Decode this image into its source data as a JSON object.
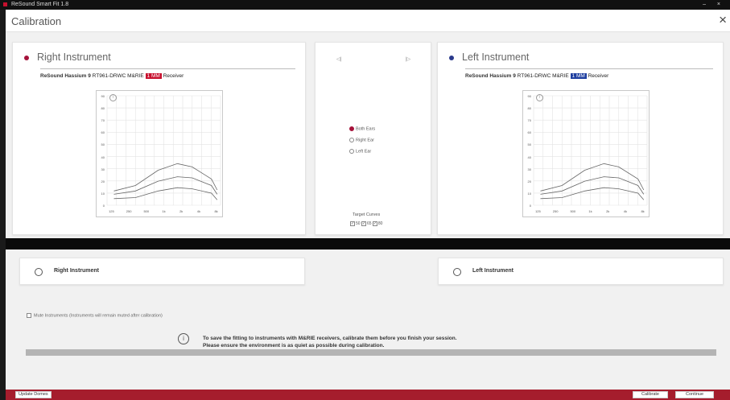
{
  "titlebar": {
    "app_title": "ReSound Smart Fit 1.8",
    "controls": "– ×"
  },
  "header": {
    "title": "Calibration",
    "close_glyph": "×"
  },
  "right_instrument": {
    "title": "Right Instrument",
    "dot_color": "#a5123a",
    "brand": "ReSound Hassium 9",
    "receiver_model": "RT961-DRWC M&RIE",
    "mm_badge": "1 MM",
    "mm_color": "#c8102e",
    "receiver_label": "Receiver"
  },
  "left_instrument": {
    "title": "Left Instrument",
    "dot_color": "#2a3a8c",
    "brand": "ReSound Hassium 9",
    "receiver_model": "RT961-DRWC M&RIE",
    "mm_badge": "1 MM",
    "mm_color": "#1f3fa0",
    "receiver_label": "Receiver"
  },
  "graph": {
    "info_glyph": "i",
    "y_ticks": [
      "90",
      "80",
      "70",
      "60",
      "50",
      "40",
      "30",
      "20",
      "10",
      "0"
    ],
    "x_ticks": [
      "125",
      "250",
      "500",
      "1k",
      "2k",
      "4k",
      "8k"
    ],
    "curves": [
      [
        [
          0.06,
          0.87
        ],
        [
          0.25,
          0.82
        ],
        [
          0.45,
          0.68
        ],
        [
          0.62,
          0.62
        ],
        [
          0.75,
          0.65
        ],
        [
          0.92,
          0.76
        ],
        [
          0.97,
          0.86
        ]
      ],
      [
        [
          0.06,
          0.9
        ],
        [
          0.25,
          0.87
        ],
        [
          0.45,
          0.78
        ],
        [
          0.62,
          0.74
        ],
        [
          0.75,
          0.75
        ],
        [
          0.92,
          0.82
        ],
        [
          0.97,
          0.9
        ]
      ],
      [
        [
          0.06,
          0.94
        ],
        [
          0.25,
          0.93
        ],
        [
          0.45,
          0.87
        ],
        [
          0.62,
          0.84
        ],
        [
          0.75,
          0.85
        ],
        [
          0.92,
          0.89
        ],
        [
          0.97,
          0.95
        ]
      ]
    ]
  },
  "center": {
    "right_icon": "◁|",
    "left_icon": "|▷",
    "ear_options": [
      {
        "label": "Both Ears",
        "selected": true
      },
      {
        "label": "Right Ear",
        "selected": false
      },
      {
        "label": "Left Ear",
        "selected": false
      }
    ],
    "target_curves_label": "Target Curves",
    "target_curves": [
      {
        "label": "50",
        "checked": true
      },
      {
        "label": "65",
        "checked": true
      },
      {
        "label": "80",
        "checked": true
      }
    ],
    "check_glyph": "✓"
  },
  "selection": {
    "right_label": "Right Instrument",
    "left_label": "Left Instrument"
  },
  "mute": {
    "label": "Mute Instruments (Instruments will remain muted after calibration)",
    "checked": false
  },
  "message": {
    "info_glyph": "i",
    "line1": "To save the fitting to instruments with M&RIE receivers, calibrate them before you finish your session.",
    "line2": "Please ensure the environment is as quiet as possible during calibration."
  },
  "progress": {
    "value": 0
  },
  "footer": {
    "update_domes": "Update Domes",
    "calibrate": "Calibrate",
    "continue": "Continue"
  },
  "colors": {
    "accent": "#a51d2d"
  }
}
